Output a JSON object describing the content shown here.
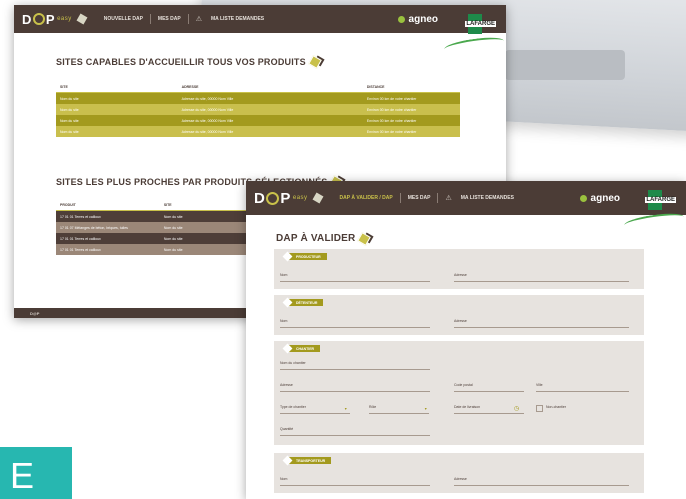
{
  "back_window": {
    "logo": "D@P",
    "logo_suffix": "easy",
    "menu": [
      "NOUVELLE DAP",
      "MES DAP",
      "Ma liste Demandes"
    ],
    "brand": "agneo",
    "client_logo": "LAFARGE",
    "section1": {
      "title": "SITES CAPABLES D'ACCUEILLIR TOUS VOS PRODUITS",
      "columns": [
        "SITE",
        "ADRESSE",
        "DISTANCE"
      ],
      "rows": [
        [
          "Nom du site",
          "Adresse du site, 00000 Nom Ville",
          "Environ 00 km de votre chantier"
        ],
        [
          "Nom du site",
          "Adresse du site, 00000 Nom Ville",
          "Environ 00 km de votre chantier"
        ],
        [
          "Nom du site",
          "Adresse du site, 00000 Nom Ville",
          "Environ 00 km de votre chantier"
        ],
        [
          "Nom du site",
          "Adresse du site, 00000 Nom Ville",
          "Environ 00 km de votre chantier"
        ]
      ]
    },
    "section2": {
      "title": "SITES LES PLUS PROCHES PAR PRODUITS SÉLECTIONNÉS",
      "columns": [
        "PRODUIT",
        "SITE"
      ],
      "rows": [
        [
          "17 01 01 Terres et cailloux",
          "Nom du site"
        ],
        [
          "17 01 07 Mélanges de béton, briques, tuiles",
          "Nom du site"
        ],
        [
          "17 01 01 Terres et cailloux",
          "Nom du site"
        ],
        [
          "17 01 01 Terres et cailloux",
          "Nom du site"
        ]
      ]
    },
    "footer": "D@P"
  },
  "front_window": {
    "logo": "D@P",
    "logo_suffix": "easy",
    "menu": [
      "DAP À VALIDER / DAP",
      "MES DAP",
      "Ma liste Demandes"
    ],
    "brand": "agneo",
    "client_logo": "LAFARGE",
    "title": "DAP À VALIDER",
    "panels": [
      {
        "tag": "PRODUCTEUR",
        "fields": [
          "Nom",
          "Adresse"
        ]
      },
      {
        "tag": "DÉTENTEUR",
        "fields": [
          "Nom",
          "Adresse"
        ]
      },
      {
        "tag": "CHANTIER",
        "fields": [
          "Nom du chantier",
          "Adresse",
          "Code postal",
          "Ville",
          "Type de chantier",
          "Rôle",
          "Date de livraison",
          "Non-chantier",
          "Quantité"
        ]
      },
      {
        "tag": "TRANSPORTEUR",
        "fields": [
          "Nom",
          "Adresse"
        ]
      }
    ]
  },
  "corner_box": {
    "letter": "E"
  }
}
